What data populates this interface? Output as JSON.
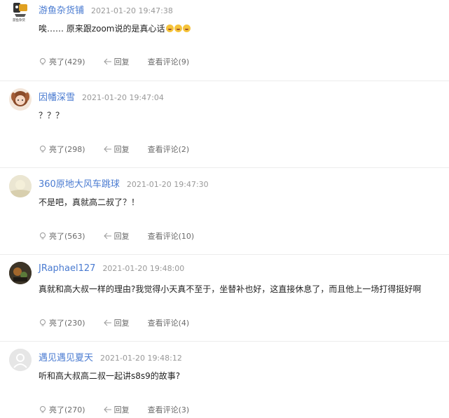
{
  "comments": [
    {
      "username": "游鱼杂货铺",
      "time": "2021-01-20 19:47:38",
      "text": "唉…… 原来跟zoom说的是真心话",
      "emoji_count": 3,
      "like_label": "亮了(429)",
      "reply_label": "回复",
      "view_label": "查看评论(9)",
      "avatar": "shop-logo",
      "avatar_caption": "游鱼杂货"
    },
    {
      "username": "因幡深雪",
      "time": "2021-01-20 19:47:04",
      "text": "？？？",
      "like_label": "亮了(298)",
      "reply_label": "回复",
      "view_label": "查看评论(2)",
      "avatar": "anime-girl"
    },
    {
      "username": "360原地大风车跳球",
      "time": "2021-01-20 19:47:30",
      "text": "不是吧，真就高二叔了？！",
      "like_label": "亮了(563)",
      "reply_label": "回复",
      "view_label": "查看评论(10)",
      "avatar": "photo"
    },
    {
      "username": "JRaphael127",
      "time": "2021-01-20 19:48:00",
      "text": "真就和高大叔一样的理由?我觉得小天真不至于，坐替补也好，这直接休息了，而且他上一场打得挺好啊",
      "like_label": "亮了(230)",
      "reply_label": "回复",
      "view_label": "查看评论(4)",
      "avatar": "photo-dark"
    },
    {
      "username": "遇见遇见夏天",
      "time": "2021-01-20 19:48:12",
      "text": "听和高大叔高二叔一起讲s8s9的故事?",
      "like_label": "亮了(270)",
      "reply_label": "回复",
      "view_label": "查看评论(3)",
      "avatar": "default-user"
    }
  ],
  "colors": {
    "username": "#4a7bd1",
    "time": "#999999",
    "action": "#6b6b6b",
    "divider": "#ececec"
  }
}
